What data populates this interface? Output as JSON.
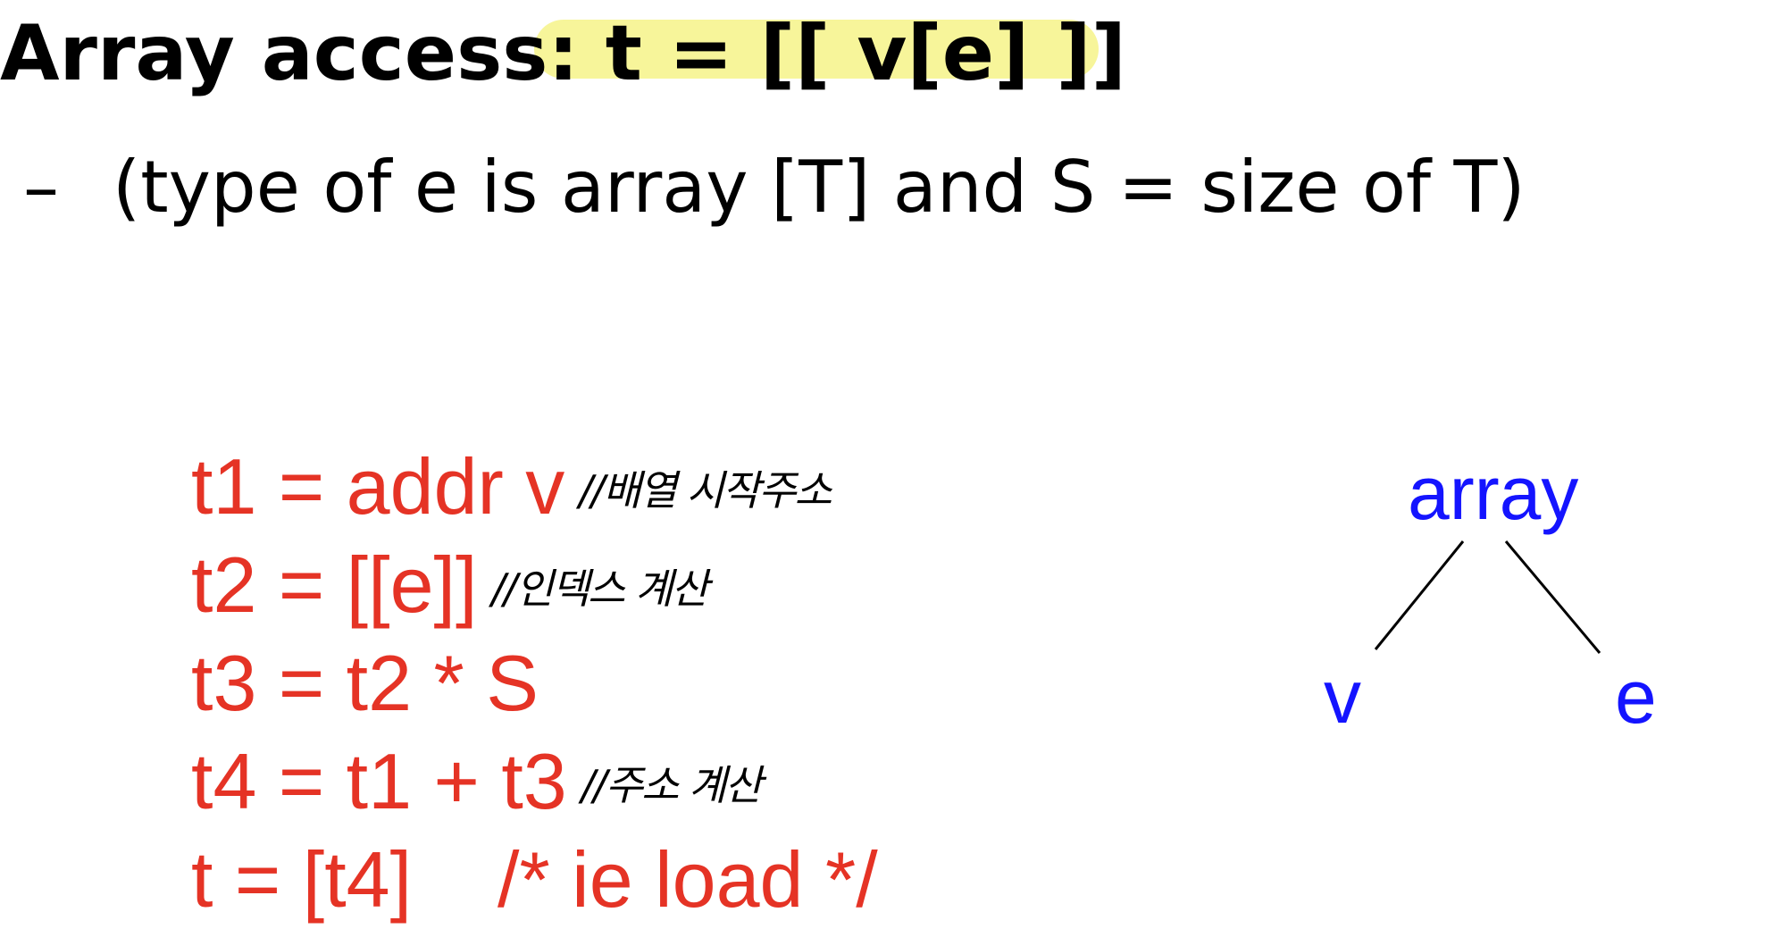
{
  "slide": {
    "title_prefix": "Array access: ",
    "title_code": "t = [[ v[e] ]]",
    "subtitle_dash": "–",
    "subtitle": "(type of e is array [T] and S = size of T)"
  },
  "code": [
    {
      "text": "t1 = addr v",
      "note": "//배열 시작주소"
    },
    {
      "text": "t2 = [[e]]",
      "note": "//인덱스 계산"
    },
    {
      "text": "t3 = t2 * S",
      "note": ""
    },
    {
      "text": "t4 = t1 + t3",
      "note": "//주소 계산"
    },
    {
      "text": "t = [t4]",
      "comment": "/* ie load */"
    }
  ],
  "tree": {
    "root": "array",
    "left": "v",
    "right": "e"
  },
  "colors": {
    "code": "#e53325",
    "tree": "#1414ff",
    "highlight": "#f6f48f"
  }
}
